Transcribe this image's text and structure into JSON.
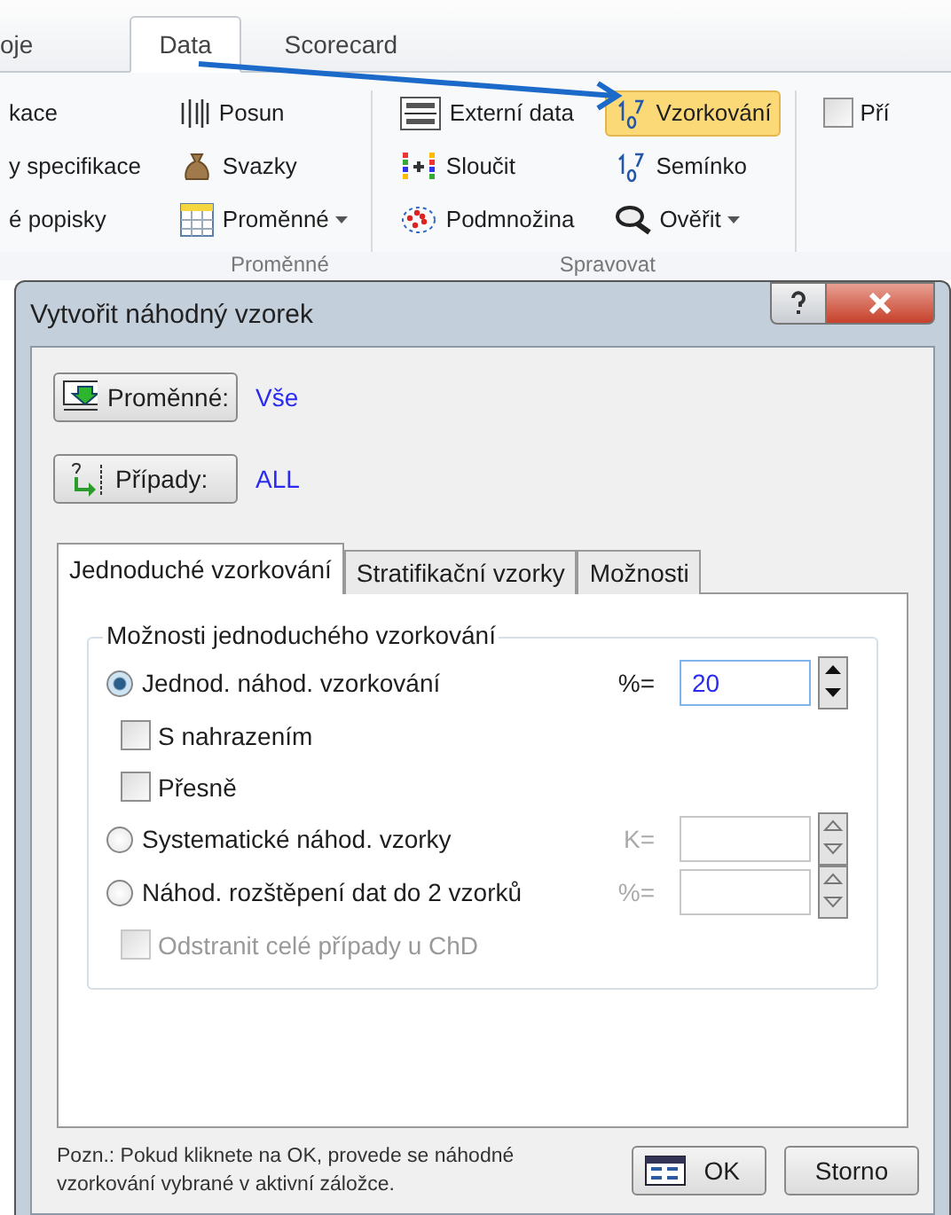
{
  "ribbon": {
    "tabs": [
      {
        "label": "oje",
        "selected": false
      },
      {
        "label": "Data",
        "selected": true
      },
      {
        "label": "Scorecard",
        "selected": false
      }
    ],
    "columns": [
      {
        "items": [
          {
            "label": "kace",
            "selected": false
          },
          {
            "label": "y specifikace",
            "selected": false
          },
          {
            "label": "é popisky",
            "selected": false
          }
        ]
      },
      {
        "items": [
          {
            "label": "Posun",
            "selected": false
          },
          {
            "label": "Svazky",
            "selected": false
          },
          {
            "label": "Proměnné",
            "selected": false,
            "dropdown": true
          }
        ]
      },
      {
        "items": [
          {
            "label": "Externí data",
            "selected": false
          },
          {
            "label": "Sloučit",
            "selected": false
          },
          {
            "label": "Podmnožina",
            "selected": false
          }
        ]
      },
      {
        "items": [
          {
            "label": "Vzorkování",
            "selected": true
          },
          {
            "label": "Semínko",
            "selected": false
          },
          {
            "label": "Ověřit",
            "selected": false,
            "dropdown": true
          }
        ]
      },
      {
        "items": [
          {
            "label": "Pří",
            "checked": false
          }
        ]
      }
    ],
    "group_labels": [
      "Proměnné",
      "Spravovat"
    ]
  },
  "dialog": {
    "title": "Vytvořit náhodný vzorek",
    "selectors": [
      {
        "label": "Proměnné:",
        "value": "Vše"
      },
      {
        "label": "Případy:",
        "value": "ALL"
      }
    ],
    "tabs": [
      {
        "label": "Jednoduché vzorkování",
        "selected": true
      },
      {
        "label": "Stratifikační vzorky",
        "selected": false
      },
      {
        "label": "Možnosti",
        "selected": false
      }
    ],
    "group": {
      "title": "Možnosti jednoduchého vzorkování",
      "options": [
        {
          "kind": "radio",
          "label": "Jednod. náhod. vzorkování",
          "selected": true,
          "field": {
            "label": "%=",
            "value": "20",
            "disabled": false
          }
        },
        {
          "kind": "checkbox",
          "label": "S nahrazením",
          "checked": false,
          "disabled": false
        },
        {
          "kind": "checkbox",
          "label": "Přesně",
          "checked": false,
          "disabled": false
        },
        {
          "kind": "radio",
          "label": "Systematické náhod. vzorky",
          "selected": false,
          "field": {
            "label": "K=",
            "disabled": true
          }
        },
        {
          "kind": "radio",
          "label": "Náhod. rozštěpení dat do 2 vzorků",
          "selected": false,
          "field": {
            "label": "%=",
            "disabled": true
          }
        },
        {
          "kind": "checkbox",
          "label": "Odstranit celé případy u ChD",
          "checked": false,
          "disabled": true
        }
      ]
    },
    "note": "Pozn.: Pokud kliknete na OK, provede se náhodné vzorkování vybrané v aktivní záložce.",
    "buttons": [
      {
        "label": "OK"
      },
      {
        "label": "Storno"
      }
    ]
  }
}
